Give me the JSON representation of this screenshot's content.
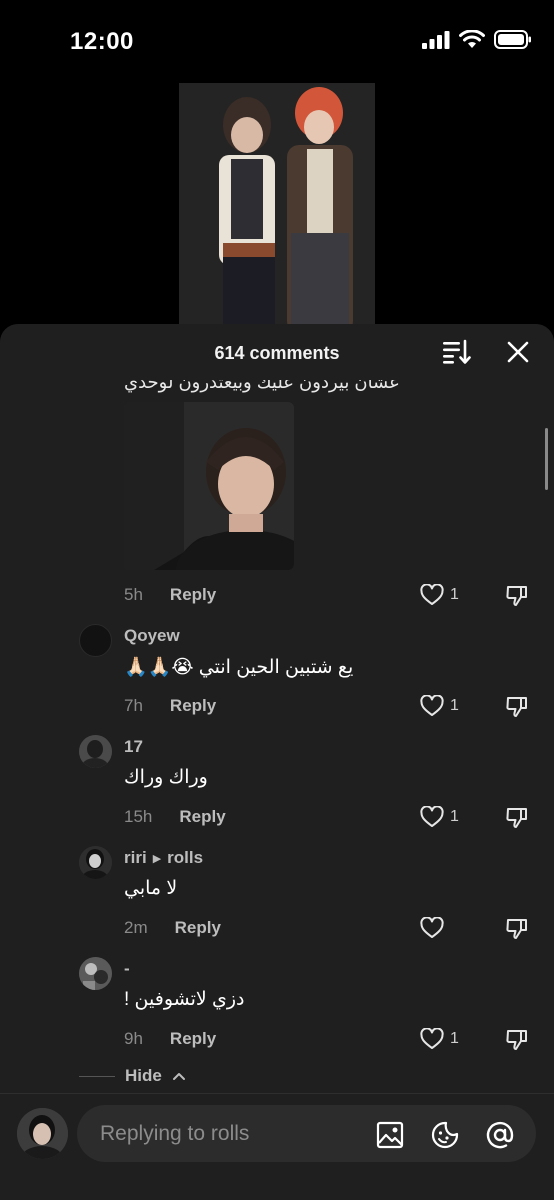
{
  "status_bar": {
    "time": "12:00"
  },
  "header": {
    "comment_count": "614 comments"
  },
  "top_comment": {
    "clipped_text": "عشان بيردون عليك وبيعتذرون لوحدي",
    "timestamp": "5h",
    "reply_label": "Reply",
    "likes": "1"
  },
  "comments": [
    {
      "username": "Qoyew",
      "text": "يع شتبين الحين انتي 😭🙏🏻🙏🏻",
      "timestamp": "7h",
      "reply_label": "Reply",
      "likes": "1"
    },
    {
      "username": "17",
      "text": "وراك وراك",
      "timestamp": "15h",
      "reply_label": "Reply",
      "likes": "1"
    },
    {
      "username": "riri",
      "reply_to": "rolls",
      "text": "لا مابي",
      "timestamp": "2m",
      "reply_label": "Reply",
      "likes": ""
    },
    {
      "username": "-",
      "text": "دزي لاتشوفين !",
      "timestamp": "9h",
      "reply_label": "Reply",
      "likes": "1"
    }
  ],
  "hide_label": "Hide",
  "composer": {
    "placeholder": "Replying to rolls"
  },
  "icons": [
    "signal-icon",
    "wifi-icon",
    "battery-icon",
    "sort-icon",
    "close-icon",
    "heart-icon",
    "dislike-icon",
    "chevron-up-icon",
    "image-icon",
    "emoji-icon",
    "mention-icon"
  ],
  "colors": {
    "sheet_bg": "#1f1f1f",
    "input_bg": "#2c2c2c",
    "muted_text": "#8a8a8a"
  }
}
